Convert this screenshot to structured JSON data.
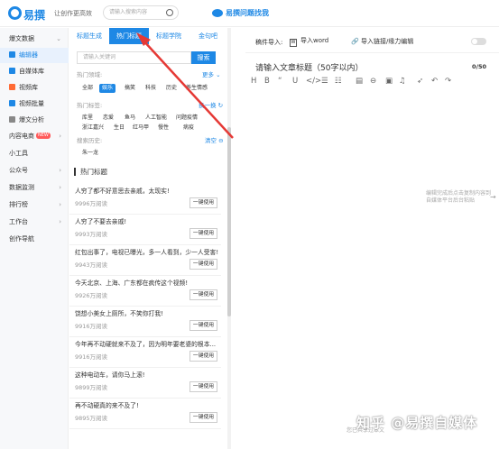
{
  "header": {
    "logo_text": "易撰",
    "slogan": "让创作更高效",
    "search_placeholder": "请输入搜索内容",
    "promo_text": "易撰问题找我"
  },
  "sidebar": {
    "items": [
      {
        "label": "爆文数据",
        "arrow": "⌄"
      },
      {
        "label": "编辑器",
        "active": true
      },
      {
        "label": "自媒体库"
      },
      {
        "label": "视频库"
      },
      {
        "label": "视频批量"
      },
      {
        "label": "爆文分析"
      },
      {
        "label": "内容电商",
        "badge": "NEW",
        "arrow": "›"
      },
      {
        "label": "小工具"
      },
      {
        "label": "公众号",
        "arrow": "›"
      },
      {
        "label": "数据监测",
        "arrow": "›"
      },
      {
        "label": "排行榜",
        "arrow": "›"
      },
      {
        "label": "工作台",
        "arrow": "›"
      },
      {
        "label": "创作导航"
      }
    ]
  },
  "panel": {
    "tabs": [
      "标题生成",
      "热门标题",
      "标题学院",
      "金句吧"
    ],
    "keyword_placeholder": "请输入关键词",
    "search_button": "搜索",
    "hot_domain_label": "热门领域:",
    "more_label": "更多 ⌄",
    "domains": [
      "全部",
      "娱乐",
      "搞笑",
      "科技",
      "历史",
      "养生情感"
    ],
    "hot_tags_label": "热门标签:",
    "refresh_label": "换一换 ↻",
    "tags_row1": [
      "库里",
      "恋爱",
      "鱼马",
      "人工智能",
      "问题疫情"
    ],
    "tags_row2": [
      "浙江嘉兴",
      "生日",
      "红马甲",
      "慢性",
      "病疫"
    ],
    "history_label": "搜索历史:",
    "clear_label": "清空 ⊖",
    "history": [
      "朱一龙"
    ],
    "section_title": "热门标题",
    "use_button": "一键使用",
    "rows": [
      {
        "title": "人穷了都不好意思去亲戚，太现实!",
        "reads": "9996万阅读"
      },
      {
        "title": "人穷了不要去亲戚!",
        "reads": "9993万阅读"
      },
      {
        "title": "红包出事了，电视已曝光，多一人看到，少一人受害!",
        "reads": "9943万阅读"
      },
      {
        "title": "今天北京、上海、广东都在疯传这个视频!",
        "reads": "9926万阅读"
      },
      {
        "title": "饶想小美女上厕所，不笑你打我!",
        "reads": "9916万阅读"
      },
      {
        "title": "今年再不动硬就来不及了，因为明年要老婆的根本...",
        "reads": "9916万阅读"
      },
      {
        "title": "这种电动车，请你马上滚!",
        "reads": "9899万阅读"
      },
      {
        "title": "再不动硬真的来不及了!",
        "reads": "9895万阅读"
      }
    ]
  },
  "editor": {
    "import_label": "稿件导入:",
    "import_word": "导入word",
    "import_link": "导入链接/缘力编辑",
    "title_placeholder": "请输入文章标题（50字以内）",
    "title_count": "0/50",
    "format_buttons": [
      "H",
      "B",
      "“",
      "U",
      "</>",
      "☰",
      "☷",
      "▤",
      "⊖",
      "▣",
      "♫",
      "➶",
      "↶",
      "↷"
    ],
    "hint_text": "编辑完成后点击复制内容到自媒体平台后台粘贴",
    "bottom_text": "您已共享过本文"
  },
  "watermark": "知乎 @易撰自媒体",
  "colors": {
    "accent": "#1e88e5",
    "arrow": "#e53935"
  }
}
